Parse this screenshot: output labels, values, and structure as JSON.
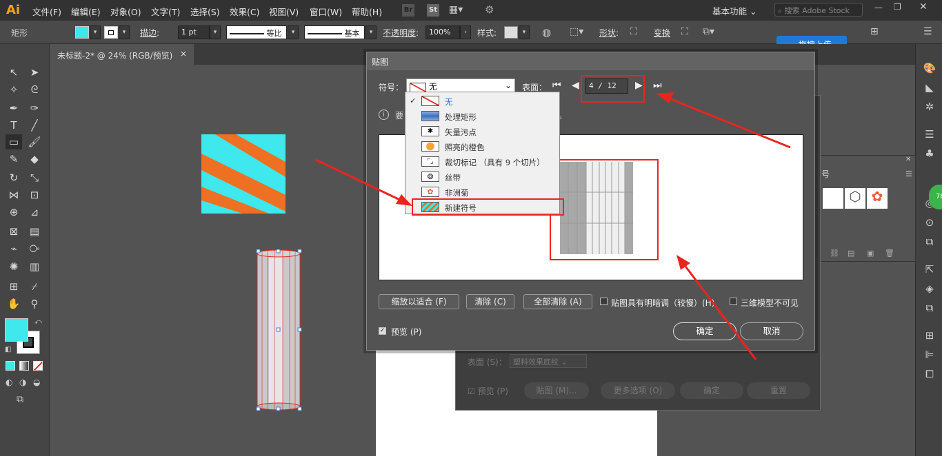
{
  "app": {
    "logo": "Ai",
    "workspace": "基本功能",
    "search_placeholder": "搜索 Adobe Stock",
    "upload_label": "拖拽上传",
    "badge": "78"
  },
  "menu": [
    "文件(F)",
    "编辑(E)",
    "对象(O)",
    "文字(T)",
    "选择(S)",
    "效果(C)",
    "视图(V)",
    "窗口(W)",
    "帮助(H)"
  ],
  "menu_icons": {
    "br": "Br",
    "st": "St"
  },
  "control": {
    "tool_name": "矩形",
    "stroke_label": "描边",
    "stroke_value": "1 pt",
    "profile_label": "等比",
    "brush_label": "基本",
    "opacity_label": "不透明度",
    "opacity_value": "100%",
    "style_label": "样式",
    "shape_label": "形状",
    "transform_label": "变换"
  },
  "doc_tab": {
    "title": "未标题-2* @ 24% (RGB/预览)",
    "close": "×"
  },
  "colors": {
    "fill": "#3ee8ec",
    "accent": "#e8261e",
    "orange": "#ee7022"
  },
  "dialog": {
    "title": "贴图",
    "symbol_label": "符号：",
    "symbol_value": "无",
    "surface_label": "表面：",
    "surface_value": "4 / 12",
    "info_prefix": "要",
    "info_suffix": "。",
    "fit_button": "缩放以适合 (F)",
    "clear_button": "清除 (C)",
    "clear_all_button": "全部清除 (A)",
    "shade_label": "贴图具有明暗调（较慢）(H)",
    "invisible_label": "三维模型不可见",
    "preview_label": "预览 (P)",
    "ok_button": "确定",
    "cancel_button": "取消"
  },
  "symbol_menu": [
    {
      "label": "无",
      "selected": true
    },
    {
      "label": "处理矩形",
      "selected": false
    },
    {
      "label": "矢量污点",
      "selected": false
    },
    {
      "label": "照亮的橙色",
      "selected": false
    },
    {
      "label": "裁切标记 （具有 9 个切片）",
      "selected": false
    },
    {
      "label": "丝带",
      "selected": false
    },
    {
      "label": "非洲菊",
      "selected": false
    },
    {
      "label": "新建符号",
      "selected": false
    }
  ],
  "dialog_behind": {
    "surface_label": "表面 (S)：",
    "surface_value": "塑料效果底纹",
    "preview_label": "预览 (P)",
    "map_button": "贴图 (M)...",
    "more_button": "更多选项 (O)",
    "ok_button": "确定",
    "reset_button": "重置"
  },
  "symbol_panel": {
    "tab": "号"
  }
}
